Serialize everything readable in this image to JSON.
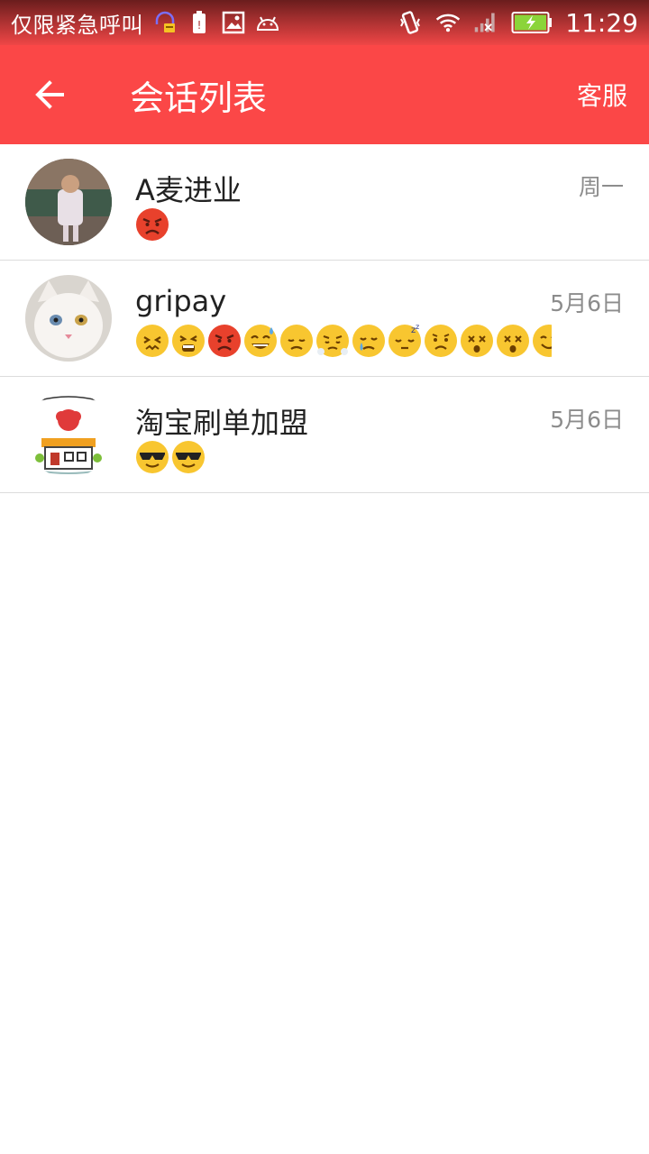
{
  "status_bar": {
    "carrier": "仅限紧急呼叫",
    "time": "11:29",
    "left_icons": [
      "headset-notification-icon",
      "battery-alert-icon",
      "image-icon",
      "android-icon"
    ],
    "right_icons": [
      "vibrate-icon",
      "wifi-icon",
      "no-signal-icon",
      "battery-charging-icon"
    ]
  },
  "header": {
    "title": "会话列表",
    "right_action": "客服",
    "background": "#fb4747"
  },
  "conversations": [
    {
      "name": "A麦进业",
      "date": "周一",
      "avatar": "child-photo-avatar",
      "preview_emoji": [
        "angry"
      ]
    },
    {
      "name": "gripay",
      "date": "5月6日",
      "avatar": "white-cat-avatar",
      "preview_emoji": [
        "confounded",
        "tired",
        "angry",
        "sweat-smile",
        "disappointed",
        "triumph",
        "crying",
        "sleepy",
        "worried",
        "astonished",
        "dizzy",
        "smile"
      ]
    },
    {
      "name": "淘宝刷单加盟",
      "date": "5月6日",
      "avatar": "shop-logo-avatar",
      "preview_emoji": [
        "sunglasses",
        "sunglasses"
      ]
    }
  ]
}
